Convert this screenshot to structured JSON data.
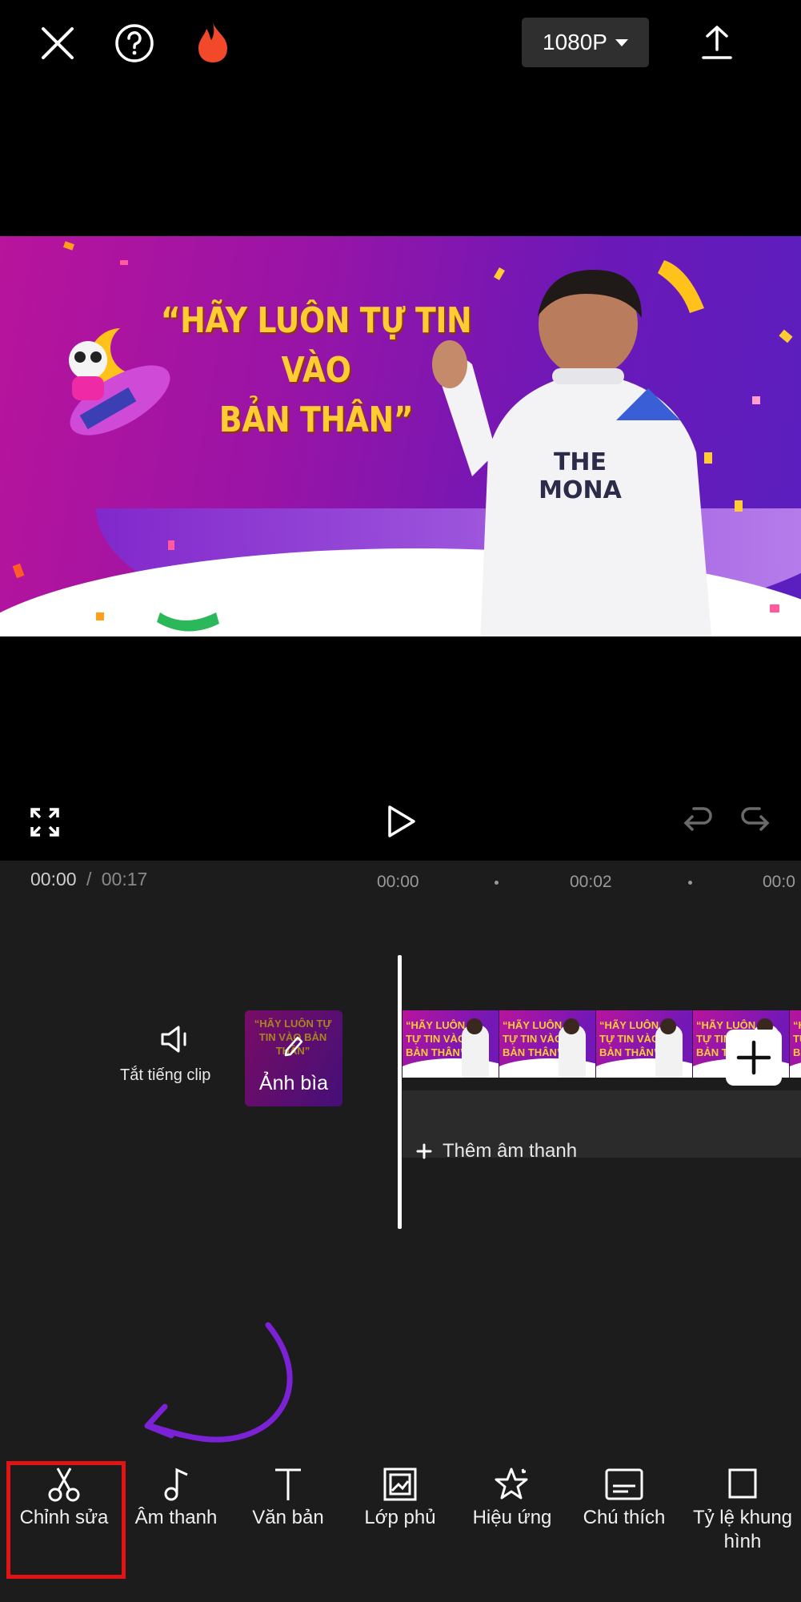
{
  "topbar": {
    "close_icon": "close-icon",
    "help_icon": "help-icon",
    "fire_icon": "fire-icon",
    "resolution": "1080P",
    "export_icon": "upload-icon"
  },
  "preview": {
    "headline_line1": "“HÃY LUÔN TỰ TIN VÀO",
    "headline_line2": "BẢN THÂN”",
    "shirt_text": "THE MONA"
  },
  "controls": {
    "fullscreen_icon": "fullscreen-icon",
    "play_icon": "play-icon",
    "undo_icon": "undo-icon",
    "redo_icon": "redo-icon"
  },
  "time": {
    "current": "00:00",
    "separator": "/",
    "total": "00:17",
    "ruler": [
      "00:00",
      "00:02",
      "00:0"
    ]
  },
  "timeline": {
    "mute_label": "Tắt tiếng clip",
    "cover_label": "Ảnh bìa",
    "thumb_text": "“HÃY LUÔN TỰ TIN VÀO BẢN THÂN”",
    "add_audio": "Thêm âm thanh"
  },
  "toolbar": {
    "items": [
      {
        "label": "Chỉnh sửa",
        "icon": "scissors-icon"
      },
      {
        "label": "Âm thanh",
        "icon": "music-note-icon"
      },
      {
        "label": "Văn bản",
        "icon": "text-icon"
      },
      {
        "label": "Lớp phủ",
        "icon": "overlay-icon"
      },
      {
        "label": "Hiệu ứng",
        "icon": "effects-star-icon"
      },
      {
        "label": "Chú thích",
        "icon": "caption-icon"
      },
      {
        "label": "Tỷ lệ khung hình",
        "icon": "aspect-ratio-icon"
      }
    ]
  },
  "colors": {
    "highlight": "#e01414",
    "arrow": "#7b22d6",
    "fire": "#f2492a",
    "headline": "#ffcc33"
  }
}
